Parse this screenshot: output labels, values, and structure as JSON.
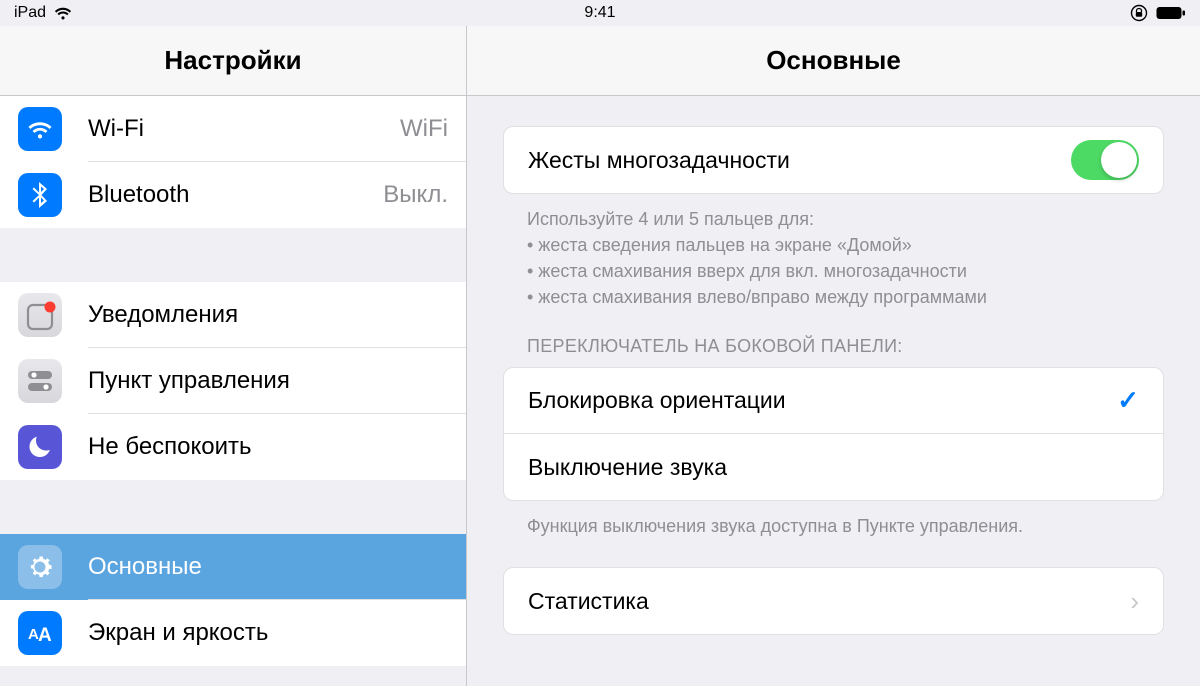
{
  "status": {
    "device": "iPad",
    "time": "9:41"
  },
  "sidebar": {
    "title": "Настройки",
    "items": {
      "wifi": {
        "label": "Wi-Fi",
        "value": "WiFi"
      },
      "bluetooth": {
        "label": "Bluetooth",
        "value": "Выкл."
      },
      "notifications": {
        "label": "Уведомления"
      },
      "control_center": {
        "label": "Пункт управления"
      },
      "dnd": {
        "label": "Не беспокоить"
      },
      "general": {
        "label": "Основные"
      },
      "display": {
        "label": "Экран и яркость"
      }
    }
  },
  "detail": {
    "title": "Основные",
    "multitasking": {
      "label": "Жесты многозадачности",
      "footer_line1": "Используйте 4 или 5 пальцев для:",
      "footer_line2": "• жеста сведения пальцев на экране «Домой»",
      "footer_line3": "• жеста смахивания вверх для вкл. многозадачности",
      "footer_line4": "• жеста смахивания влево/вправо между программами"
    },
    "side_switch": {
      "header": "ПЕРЕКЛЮЧАТЕЛЬ НА БОКОВОЙ ПАНЕЛИ:",
      "lock": {
        "label": "Блокировка ориентации",
        "selected": true
      },
      "mute": {
        "label": "Выключение звука"
      },
      "footer": "Функция выключения звука доступна в Пункте управления."
    },
    "stats": {
      "label": "Статистика"
    }
  }
}
